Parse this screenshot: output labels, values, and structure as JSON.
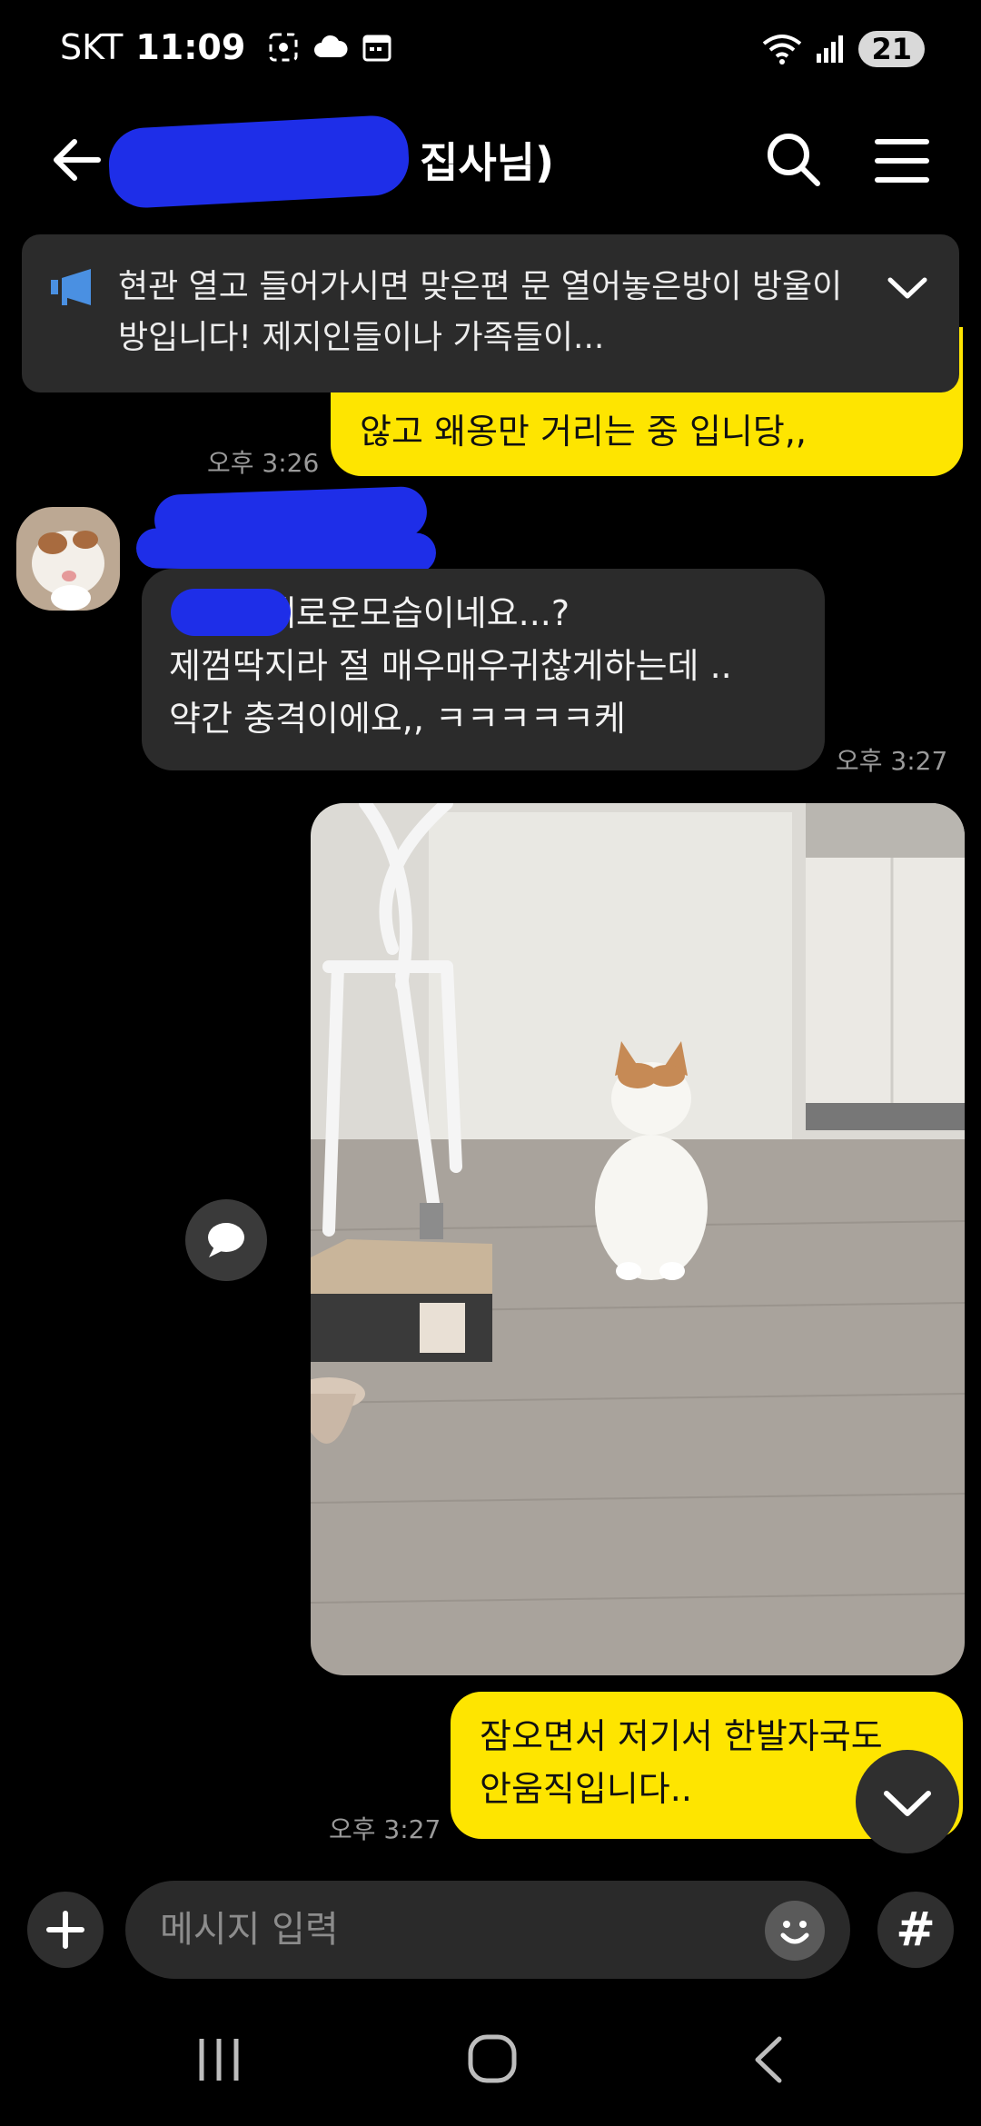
{
  "status_bar": {
    "carrier": "SKT",
    "time": "11:09",
    "battery": "21"
  },
  "header": {
    "title": "집사님)"
  },
  "notice": {
    "text": "현관 열고 들어가시면 맞은편 문 열어놓은방이 방울이방입니다! 제지인들이나 가족들이..."
  },
  "messages": {
    "m1": {
      "text": "않고 왜옹만 거리는 중 입니당,,",
      "time": "오후 3:26"
    },
    "m2": {
      "line1": "의새로운모습이네요...?",
      "line2": "제껌딱지라 절 매우매우귀찮게하는데 ..",
      "line3": "약간 충격이에요,, ㅋㅋㅋㅋㅋ케",
      "time": "오후 3:27"
    },
    "m4": {
      "line1": "잠오면서 저기서 한발자국도",
      "line2": "안움직입니다..",
      "time": "오후 3:27"
    }
  },
  "input": {
    "placeholder": "메시지 입력",
    "value": "",
    "hash_label": "#"
  },
  "colors": {
    "my_bubble": "#fee500",
    "other_bubble": "#2b2b2b",
    "background": "#000000",
    "notice_icon": "#4a90e2"
  }
}
